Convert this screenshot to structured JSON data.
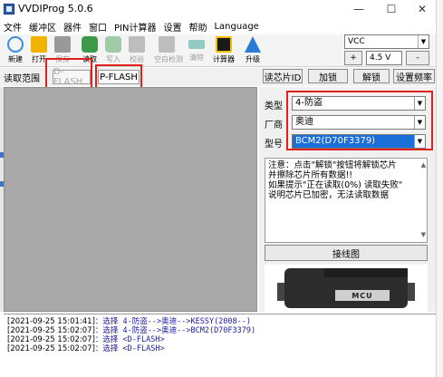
{
  "window": {
    "title": "VVDIProg 5.0.6",
    "minimize": "—",
    "maximize": "☐",
    "close": "✕"
  },
  "menu": [
    "文件",
    "缓冲区",
    "器件",
    "窗口",
    "PIN计算器",
    "设置",
    "帮助",
    "Language"
  ],
  "toolbar": {
    "buttons": [
      {
        "label": "新建",
        "icon": "new-file-icon",
        "color": "#3a8de0",
        "enabled": true
      },
      {
        "label": "打开",
        "icon": "open-folder-icon",
        "color": "#f0b400",
        "enabled": true
      },
      {
        "label": "保存",
        "icon": "save-disk-icon",
        "color": "#2a2a2a",
        "enabled": false
      },
      {
        "label": "读取",
        "icon": "read-chip-icon",
        "color": "#3a9a4a",
        "enabled": true
      },
      {
        "label": "写入",
        "icon": "write-chip-icon",
        "color": "#3a9a4a",
        "enabled": false
      },
      {
        "label": "校验",
        "icon": "verify-icon",
        "color": "#7a7a7a",
        "enabled": false
      },
      {
        "label": "空白检测",
        "icon": "blank-check-icon",
        "color": "#7a7a7a",
        "enabled": false
      },
      {
        "label": "清除",
        "icon": "erase-icon",
        "color": "#1a9a8a",
        "enabled": false
      },
      {
        "label": "计算器",
        "icon": "calculator-icon",
        "color": "#1a1a1a",
        "enabled": true
      },
      {
        "label": "升级",
        "icon": "upgrade-arrow-icon",
        "color": "#2a7ad8",
        "enabled": true
      }
    ],
    "voltage_select": "VCC",
    "plus_label": "+",
    "voltage_value": "4.5 V",
    "minus_label": "-"
  },
  "read_range": {
    "label": "读取范围",
    "dflash": "D-FLASH",
    "pflash": "P-FLASH"
  },
  "tabs": [
    "读芯片ID",
    "加锁",
    "解锁",
    "设置频率"
  ],
  "device": {
    "type_label": "类型",
    "type_value": "4-防盗",
    "maker_label": "厂商",
    "maker_value": "奥迪",
    "model_label": "型号",
    "model_value": "BCM2(D70F3379)"
  },
  "notes": [
    "注意：点击\"解锁\"按钮将解锁芯片",
    "并擦除芯片所有数据!!",
    "如果提示\"正在读取(0%) 读取失败\"",
    "说明芯片已加密，无法读取数据"
  ],
  "wiring_button": "接线图",
  "chip_text": "MCU",
  "log": [
    {
      "ts": "[2021-09-25 15:01:41]",
      "msg": "：选择 4-防盗-->奥迪-->KESSY(2008--)"
    },
    {
      "ts": "[2021-09-25 15:02:07]",
      "msg": "：选择 4-防盗-->奥迪-->BCM2(D70F3379)"
    },
    {
      "ts": "[2021-09-25 15:02:07]",
      "msg": "：选择 <D-FLASH>"
    },
    {
      "ts": "[2021-09-25 15:02:07]",
      "msg": "：选择 <D-FLASH>"
    }
  ],
  "colors": {
    "highlight_box": "#e0201a",
    "selection": "#1a6ed8",
    "log_text": "#1a1aa8",
    "canvas": "#a9a9a9"
  }
}
